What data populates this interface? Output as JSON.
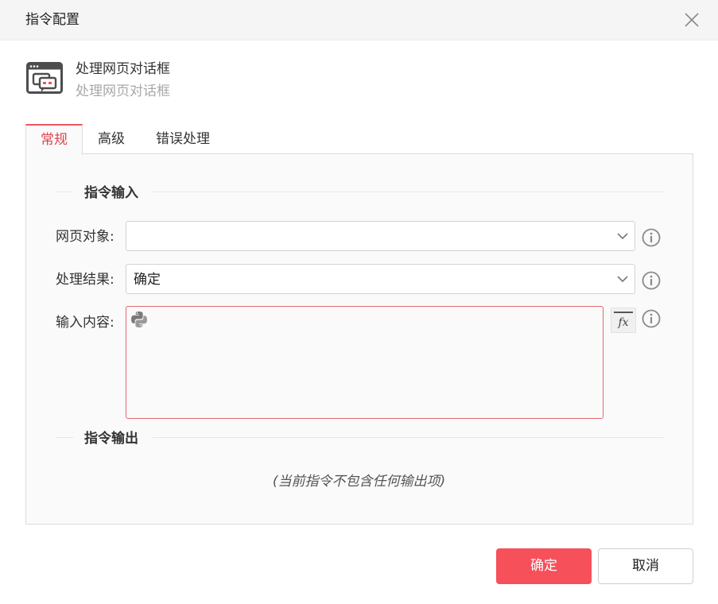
{
  "dialog": {
    "title": "指令配置"
  },
  "command": {
    "name": "处理网页对话框",
    "description": "处理网页对话框"
  },
  "tabs": [
    {
      "label": "常规",
      "active": true
    },
    {
      "label": "高级",
      "active": false
    },
    {
      "label": "错误处理",
      "active": false
    }
  ],
  "input_section": {
    "title": "指令输入",
    "fields": {
      "web_object": {
        "label": "网页对象:",
        "value": ""
      },
      "result": {
        "label": "处理结果:",
        "value": "确定"
      },
      "content": {
        "label": "输入内容:",
        "value": ""
      }
    }
  },
  "output_section": {
    "title": "指令输出",
    "empty_text": "(当前指令不包含任何输出项)"
  },
  "footer": {
    "ok_label": "确定",
    "cancel_label": "取消"
  },
  "icons": {
    "close": "close-icon",
    "command": "web-dialog-icon",
    "chevron": "chevron-down-icon",
    "info": "info-icon",
    "python": "python-icon",
    "fx": "fx-icon"
  },
  "colors": {
    "accent": "#f6505b",
    "active_tab_text": "#e0424c",
    "error_border": "#e06a70"
  }
}
